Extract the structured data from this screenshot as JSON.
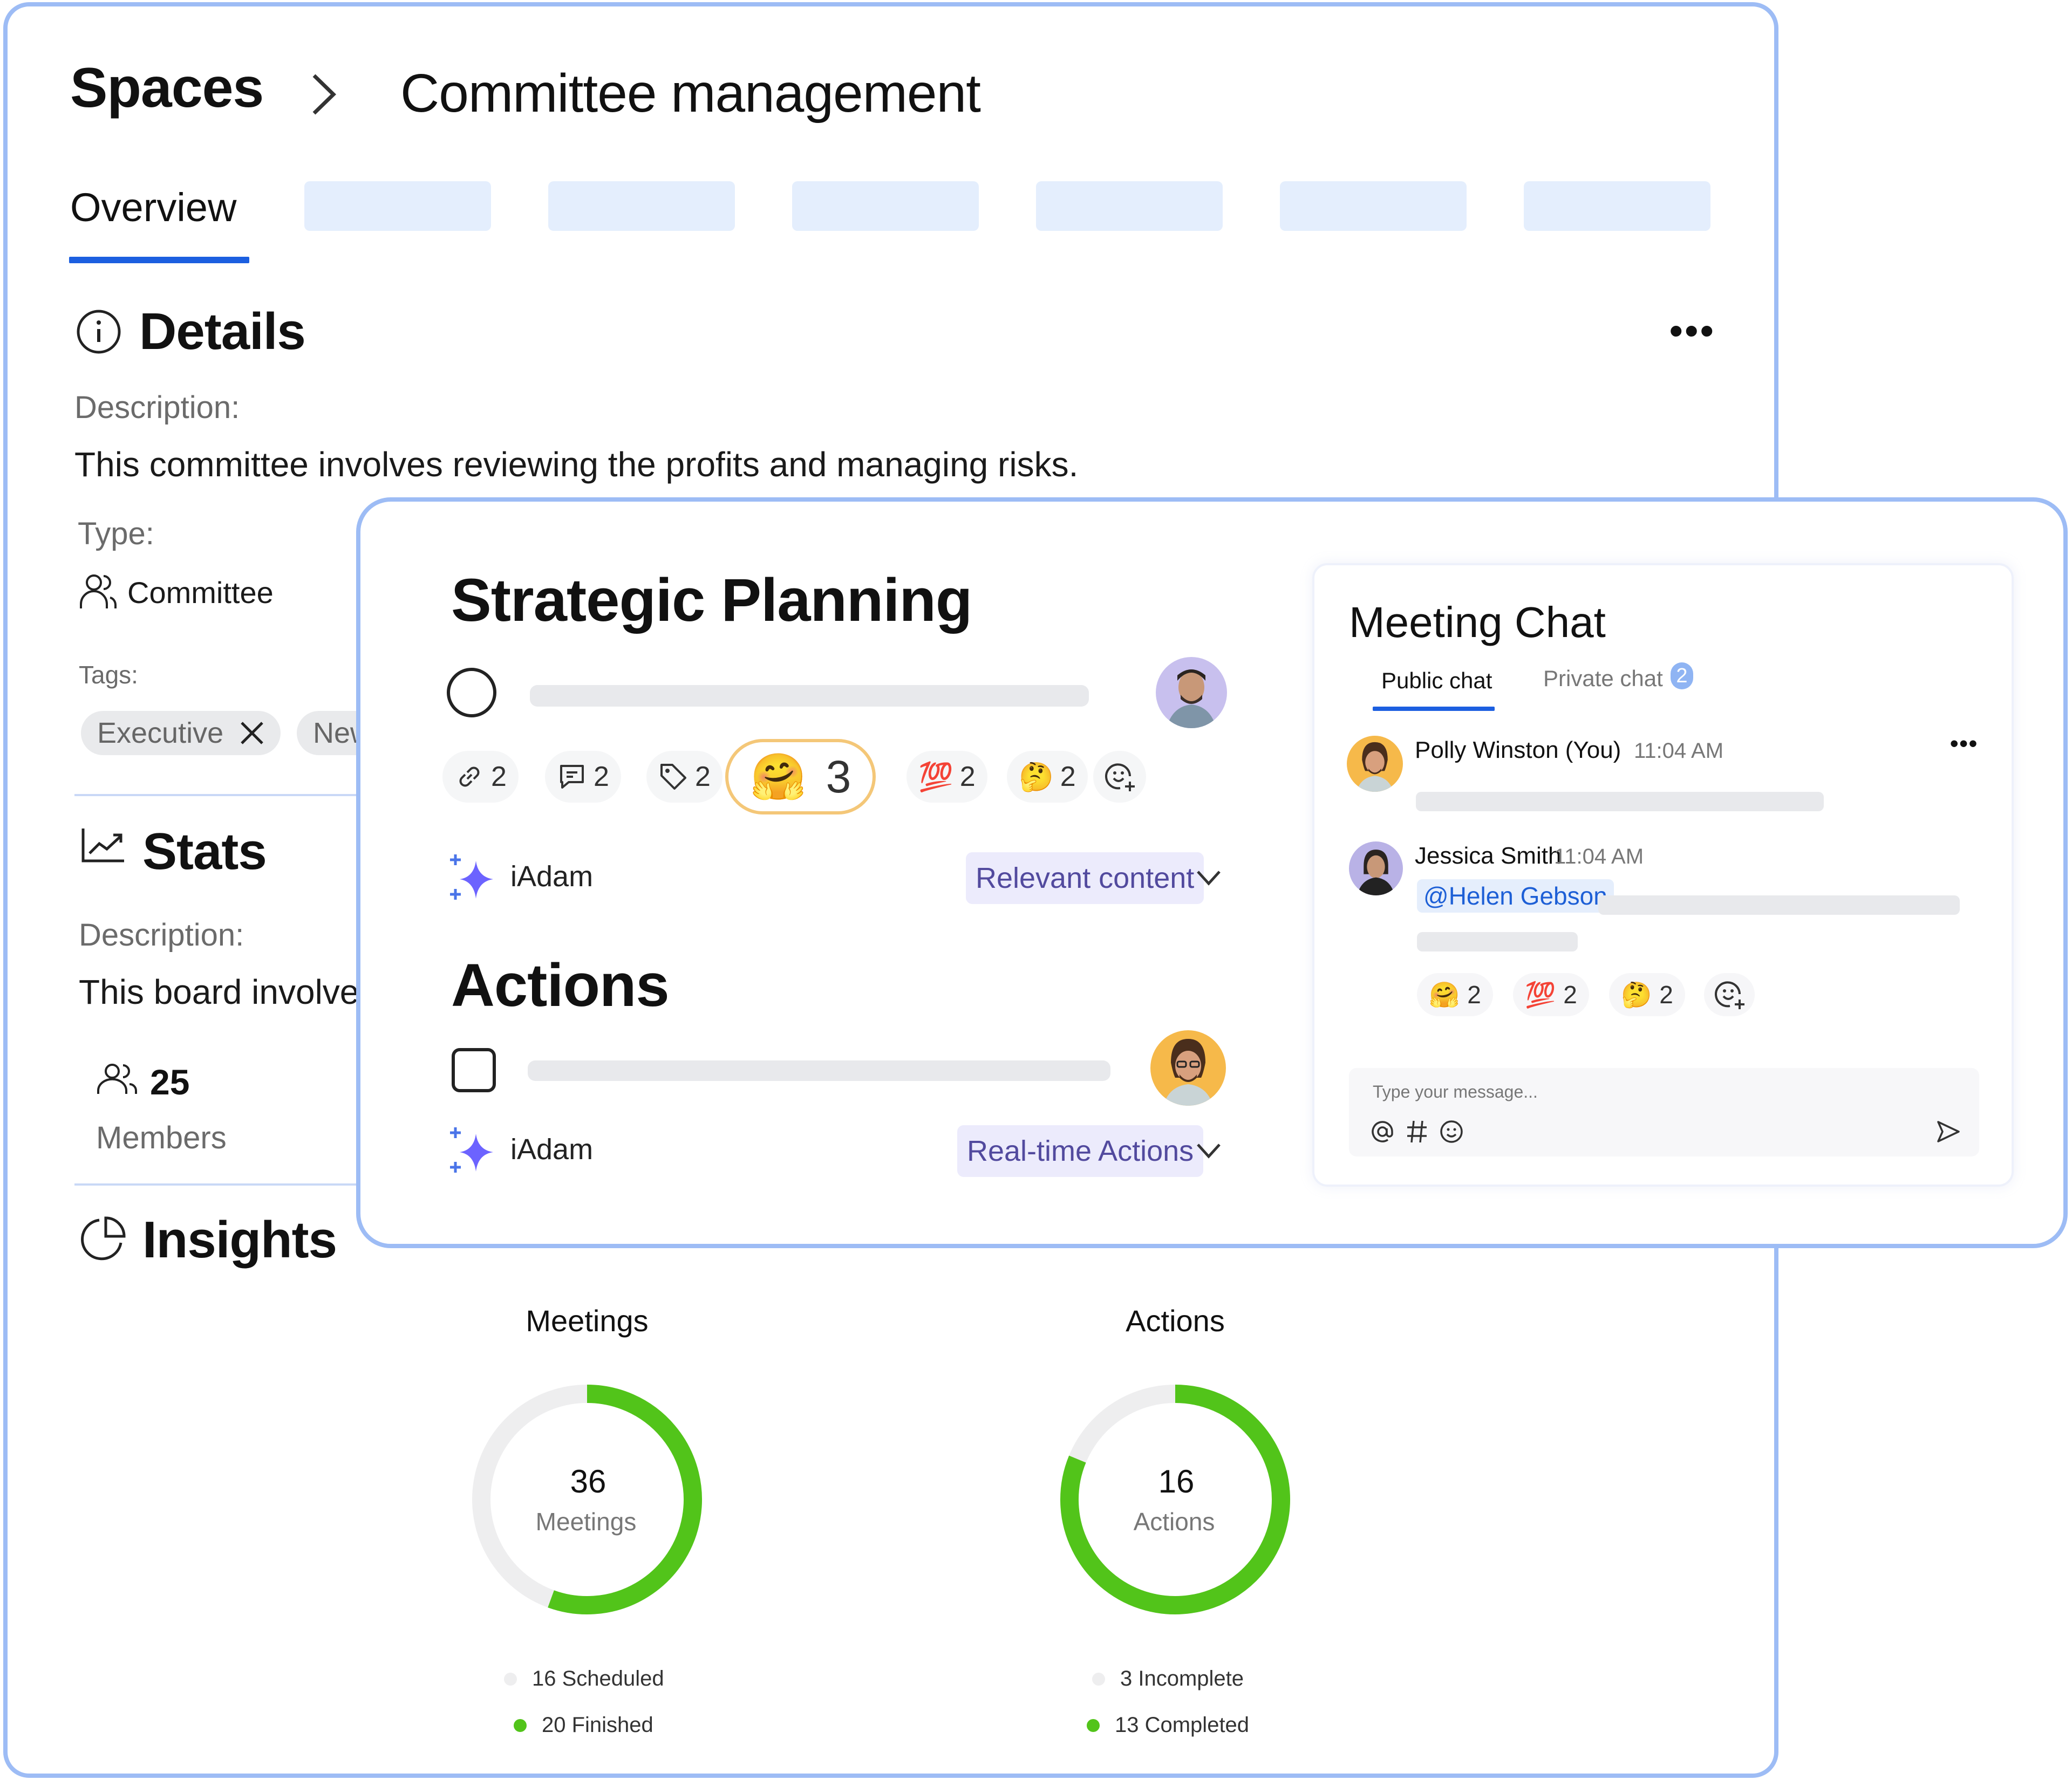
{
  "breadcrumb": {
    "root": "Spaces",
    "current": "Committee management"
  },
  "tabs": {
    "active": "Overview",
    "placeholder_count": 6
  },
  "details": {
    "title": "Details",
    "description_label": "Description:",
    "description": "This committee involves reviewing the profits and managing risks.",
    "type_label": "Type:",
    "type_value": "Committee",
    "tags_label": "Tags:",
    "tags": [
      {
        "label": "Executive",
        "removable": true
      },
      {
        "label": "New",
        "removable": false
      }
    ]
  },
  "stats": {
    "title": "Stats",
    "description_label": "Description:",
    "description": "This board involve",
    "members_count": "25",
    "members_label": "Members"
  },
  "insights": {
    "title": "Insights"
  },
  "strategic_planning": {
    "title": "Strategic Planning",
    "chips": [
      {
        "icon": "link-icon",
        "count": "2"
      },
      {
        "icon": "comment-icon",
        "count": "2"
      },
      {
        "icon": "tag-icon",
        "count": "2"
      }
    ],
    "highlight_reaction": {
      "emoji": "🤗",
      "count": "3"
    },
    "reactions": [
      {
        "emoji": "💯",
        "count": "2"
      },
      {
        "emoji": "🤔",
        "count": "2"
      }
    ],
    "ai_name": "iAdam",
    "ai_filter": "Relevant content"
  },
  "actions": {
    "title": "Actions",
    "ai_name": "iAdam",
    "ai_filter": "Real-time Actions"
  },
  "chat": {
    "title": "Meeting Chat",
    "tabs": [
      {
        "label": "Public chat",
        "active": true
      },
      {
        "label": "Private chat",
        "active": false,
        "badge": "2"
      }
    ],
    "messages": [
      {
        "author": "Polly Winston (You)",
        "time": "11:04 AM"
      },
      {
        "author": "Jessica Smith",
        "time": "11:04 AM",
        "mention": "@Helen Gebson",
        "reactions": [
          {
            "emoji": "🤗",
            "count": "2"
          },
          {
            "emoji": "💯",
            "count": "2"
          },
          {
            "emoji": "🤔",
            "count": "2"
          }
        ]
      }
    ],
    "composer_placeholder": "Type your message..."
  },
  "colors": {
    "accent": "#1c5fe0",
    "border": "#9dbcf5",
    "green": "#52c41a",
    "grey_track": "#eeeeef",
    "ai_purple": "#6c63ff"
  },
  "chart_data": [
    {
      "type": "pie",
      "title": "Meetings",
      "center_value": "36",
      "center_label": "Meetings",
      "categories": [
        "Scheduled",
        "Finished"
      ],
      "values": [
        16,
        20
      ],
      "legend": [
        "16 Scheduled",
        "20 Finished"
      ],
      "colors": [
        "#eeeeef",
        "#52c41a"
      ],
      "style": "donut"
    },
    {
      "type": "pie",
      "title": "Actions",
      "center_value": "16",
      "center_label": "Actions",
      "categories": [
        "Incomplete",
        "Completed"
      ],
      "values": [
        3,
        13
      ],
      "legend": [
        "3 Incomplete",
        "13 Completed"
      ],
      "colors": [
        "#eeeeef",
        "#52c41a"
      ],
      "style": "donut"
    }
  ]
}
